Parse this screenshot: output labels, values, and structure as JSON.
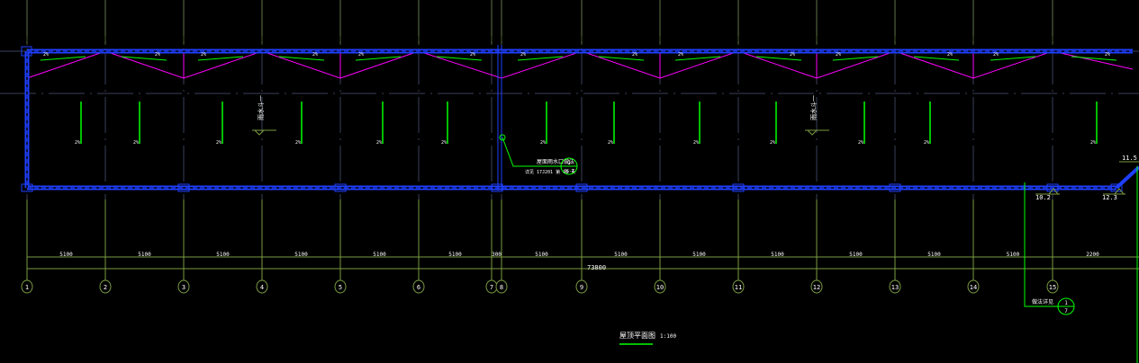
{
  "drawing": {
    "title": "屋顶平面图",
    "scale": "1:100",
    "total_dimension": "73800",
    "axes": [
      "1",
      "2",
      "3",
      "4",
      "5",
      "6",
      "7",
      "8",
      "9",
      "10",
      "11",
      "12",
      "13",
      "14",
      "15"
    ],
    "span_dimensions": [
      "5100",
      "5100",
      "5100",
      "5100",
      "5100",
      "5100",
      "300",
      "5100",
      "5100",
      "5100",
      "5100",
      "5100",
      "5100",
      "5100",
      "2200"
    ],
    "slope_label": "2%",
    "drain_label": "2%",
    "section_label": "雨水斗一",
    "elevations": [
      "10.2",
      "12.3",
      "11.5"
    ],
    "detail_callouts": [
      {
        "text": "屋面雨水口做法",
        "sub": "详见 17J201 第 18 页",
        "top": "1",
        "bottom": "JS-1"
      },
      {
        "text": "做法详见",
        "top": "1",
        "bottom": "7"
      }
    ],
    "colors": {
      "background": "#000000",
      "wall": "#1f3fff",
      "ridge": "#ff00ff",
      "slope_arrow": "#00ff00",
      "axis": "#7a9a40",
      "grid_dash": "#3a3f5a",
      "text": "#ffffff"
    }
  }
}
